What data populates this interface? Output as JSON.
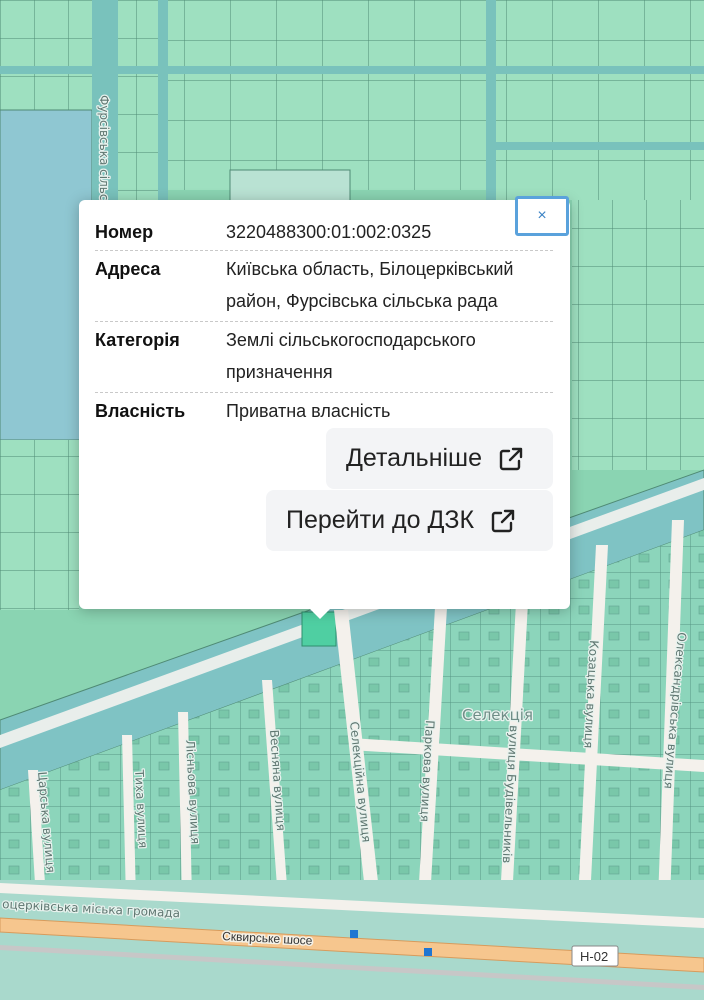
{
  "map": {
    "labels": {
      "fursivska_council": "Фурсівська сільська рада",
      "tsarska": "Царська вулиця",
      "tykha": "Тиха вулиця",
      "lisnova": "Лісньова вулиця",
      "vesniana": "Весняна вулиця",
      "selektsiina": "Селекційна вулиця",
      "parkova": "Паркова вулиця",
      "budivelnykiv": "вулиця Будівельників",
      "kozatska": "Козацька вулиця",
      "oleksandrivska": "Олександрівська вулиця",
      "selektsiia": "Селекція",
      "hromada": "Білоцерківська міська громада",
      "hromada_prefix": "оцерківська міська громада",
      "highway": "Сквирське шосе",
      "route_shield": "Н-02"
    },
    "colors": {
      "parcel": "#9ee0c0",
      "parcel_border": "#4f8a74",
      "residential": "#6fc0b7",
      "road": "#f4f1ec",
      "water": "#8fc7d2",
      "highway": "#f6c68e"
    }
  },
  "popup": {
    "close_label": "×",
    "rows": [
      {
        "key": "Номер",
        "value": "3220488300:01:002:0325"
      },
      {
        "key": "Адреса",
        "value": "Київська область, Білоцерківський район, Фурсівська сільська рада"
      },
      {
        "key": "Категорія",
        "value": "Землі сільськогосподарського призначення"
      },
      {
        "key": "Власність",
        "value": "Приватна власність"
      }
    ],
    "details_label": "Детальніше",
    "dzk_label": "Перейти до ДЗК",
    "details_icon": "external-link-icon",
    "dzk_icon": "external-link-icon"
  }
}
